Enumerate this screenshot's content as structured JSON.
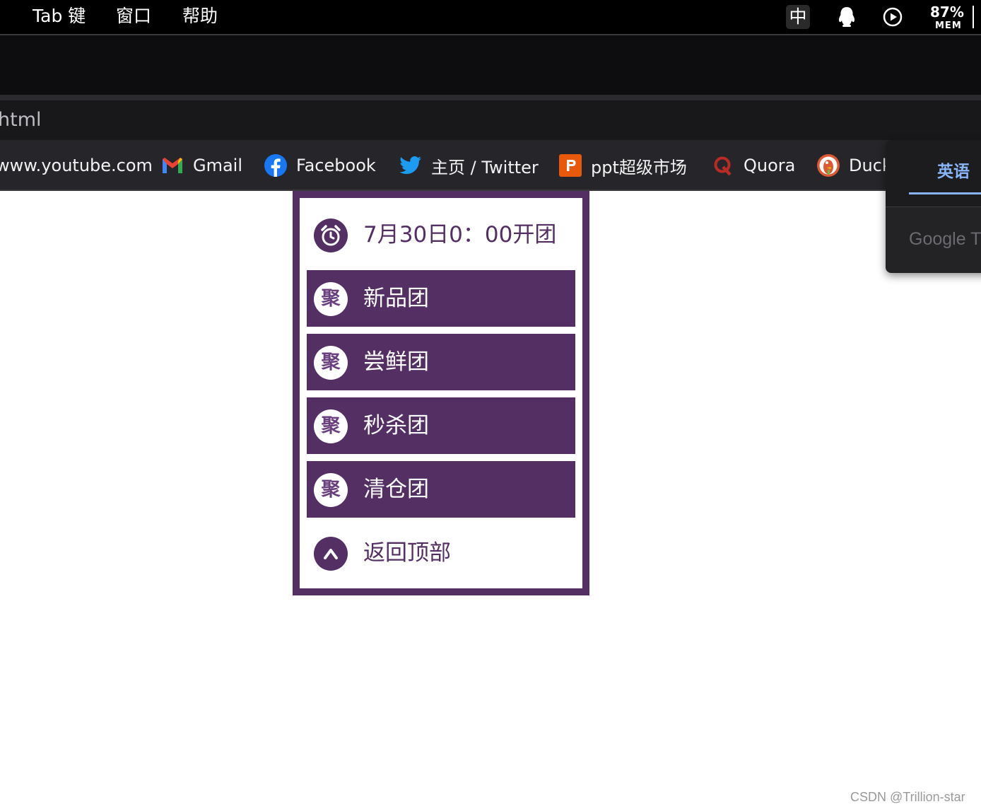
{
  "menubar": {
    "edge_glyph": "⍿",
    "items": [
      "Tab 键",
      "窗口",
      "帮助"
    ],
    "status": {
      "ime_label": "中",
      "mem_percent": "87%",
      "mem_label": "MEM"
    }
  },
  "browser": {
    "address_text": "html",
    "bookmarks": [
      {
        "label": "www.youtube.com",
        "icon": "youtube-icon"
      },
      {
        "label": "Gmail",
        "icon": "gmail-icon"
      },
      {
        "label": "Facebook",
        "icon": "facebook-icon"
      },
      {
        "label": "主页 / Twitter",
        "icon": "twitter-icon"
      },
      {
        "label": "ppt超级市场",
        "icon": "ppt-icon"
      },
      {
        "label": "Quora",
        "icon": "quora-icon"
      },
      {
        "label": "Duck",
        "icon": "duckduckgo-icon"
      }
    ],
    "translate_popup": {
      "tab_label": "英语",
      "brand": "Google Tr"
    }
  },
  "floatnav": {
    "timer_label": "7月30日0：00开团",
    "items": [
      {
        "label": "新品团",
        "icon_text": "聚"
      },
      {
        "label": "尝鲜团",
        "icon_text": "聚"
      },
      {
        "label": "秒杀团",
        "icon_text": "聚"
      },
      {
        "label": "清仓团",
        "icon_text": "聚"
      }
    ],
    "back_to_top": "返回顶部"
  },
  "watermark": "CSDN @Trillion-star",
  "colors": {
    "accent": "#532f63",
    "translate_blue": "#8ab4f8"
  }
}
